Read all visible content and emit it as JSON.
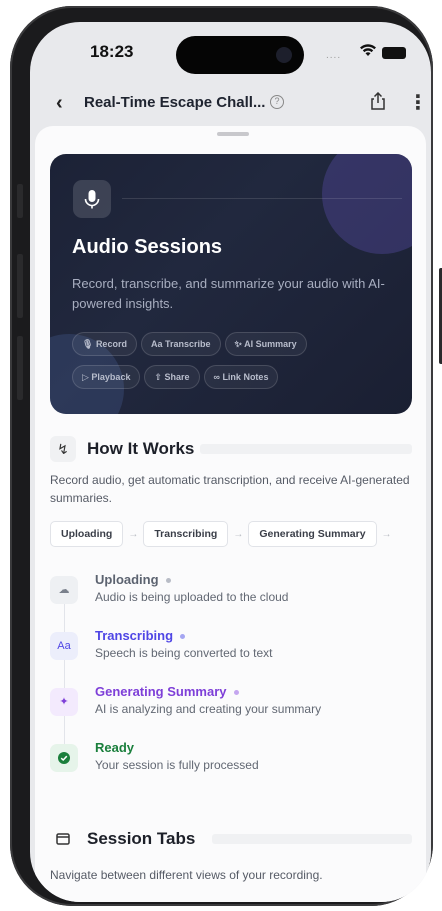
{
  "status_bar": {
    "time": "18:23",
    "signal": "....",
    "colors": {
      "island": "#050505"
    }
  },
  "nav": {
    "back_icon": "chevron-left-icon",
    "title": "Real-Time Escape Chall...",
    "info_icon": "question-circle-icon",
    "share_icon": "share-icon",
    "more_icon": "more-vertical-icon"
  },
  "hero": {
    "icon": "microphone-icon",
    "title": "Audio Sessions",
    "description": "Record, transcribe, and summarize your audio with AI-powered insights.",
    "features": [
      {
        "icon": "mic-icon",
        "label": "Record"
      },
      {
        "icon": "text-icon",
        "label": "Transcribe"
      },
      {
        "icon": "sparkle-icon",
        "label": "AI Summary"
      },
      {
        "icon": "play-icon",
        "label": "Playback"
      },
      {
        "icon": "share-icon",
        "label": "Share"
      },
      {
        "icon": "link-icon",
        "label": "Link Notes"
      }
    ],
    "colors": {
      "background": "#1c2236",
      "text": "#ffffff"
    }
  },
  "how_it_works": {
    "title": "How It Works",
    "description": "Record audio, get automatic transcription, and receive AI-generated summaries.",
    "flow": [
      "Uploading",
      "Transcribing",
      "Generating Summary"
    ],
    "steps": [
      {
        "icon": "cloud-upload-icon",
        "title": "Uploading",
        "desc": "Audio is being uploaded to the cloud",
        "color": "#5c6370",
        "icon_bg": "#eef0f3",
        "dot": "#b8bcc6"
      },
      {
        "icon": "text-aa-icon",
        "title": "Transcribing",
        "desc": "Speech is being converted to text",
        "color": "#4f46e5",
        "icon_bg": "#eceefb",
        "dot": "#a5a6f2"
      },
      {
        "icon": "sparkles-icon",
        "title": "Generating Summary",
        "desc": "AI is analyzing and creating your summary",
        "color": "#7e3fd8",
        "icon_bg": "#f3eafd",
        "dot": "#c4a6ef"
      },
      {
        "icon": "check-circle-icon",
        "title": "Ready",
        "desc": "Your session is fully processed",
        "color": "#1a7f3c",
        "icon_bg": "#e6f4ea",
        "dot": null
      }
    ]
  },
  "session_tabs": {
    "title": "Session Tabs",
    "description": "Navigate between different views of your recording."
  }
}
